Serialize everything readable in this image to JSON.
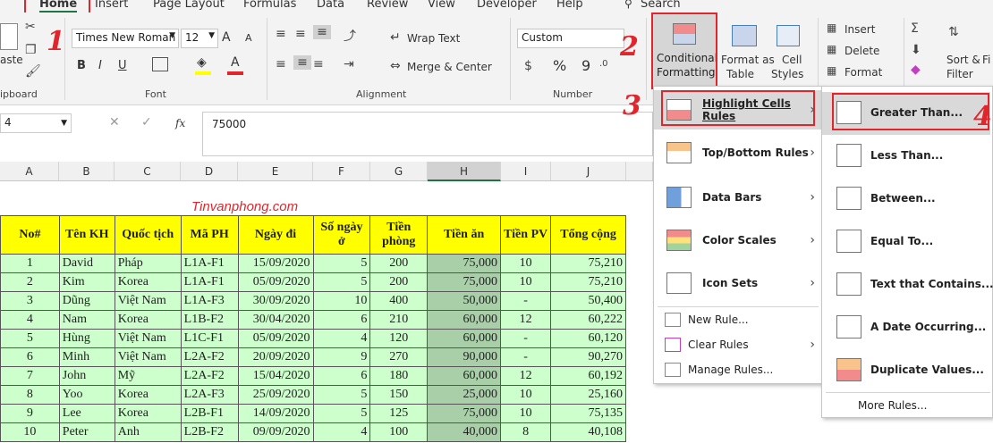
{
  "ribbon_tabs": [
    "Home",
    "Insert",
    "Page Layout",
    "Formulas",
    "Data",
    "Review",
    "View",
    "Developer",
    "Help"
  ],
  "search_label": "Search",
  "clipboard": {
    "paste": "aste",
    "group": "ipboard"
  },
  "font": {
    "name": "Times New Roman",
    "size": "12",
    "grow": "A",
    "shrink": "A",
    "bold": "B",
    "italic": "I",
    "underline": "U",
    "group": "Font"
  },
  "alignment": {
    "wrap": "Wrap Text",
    "merge": "Merge & Center",
    "group": "Alignment"
  },
  "number": {
    "format": "Custom",
    "percent": "%",
    "comma": "9",
    "group": "Number"
  },
  "styles": {
    "cf_line1": "Conditional",
    "cf_line2": "Formatting",
    "fat_line1": "Format as",
    "fat_line2": "Table",
    "cs_line1": "Cell",
    "cs_line2": "Styles"
  },
  "cells": {
    "insert": "Insert",
    "delete": "Delete",
    "format": "Format"
  },
  "editing": {
    "sort_line1": "Sort &",
    "sort_line2": "Filter",
    "find": "Fi"
  },
  "formula_bar": {
    "name_box": "4",
    "fx": "fx",
    "value": "75000"
  },
  "steps": [
    "1",
    "2",
    "3",
    "4"
  ],
  "columns": [
    "A",
    "B",
    "C",
    "D",
    "E",
    "F",
    "G",
    "H",
    "I",
    "J"
  ],
  "watermark": "Tinvanphong.com",
  "table": {
    "headers": [
      "No#",
      "Tên KH",
      "Quốc tịch",
      "Mã PH",
      "Ngày đi",
      "Số ngày ở",
      "Tiền phòng",
      "Tiền ăn",
      "Tiền PV",
      "Tổng cộng"
    ],
    "rows": [
      [
        "1",
        "David",
        "Pháp",
        "L1A-F1",
        "15/09/2020",
        "5",
        "200",
        "75,000",
        "10",
        "75,210"
      ],
      [
        "2",
        "Kim",
        "Korea",
        "L1A-F1",
        "05/09/2020",
        "5",
        "200",
        "75,000",
        "10",
        "75,210"
      ],
      [
        "3",
        "Dũng",
        "Việt Nam",
        "L1A-F3",
        "30/09/2020",
        "10",
        "400",
        "50,000",
        "-",
        "50,400"
      ],
      [
        "4",
        "Nam",
        "Korea",
        "L1B-F2",
        "30/04/2020",
        "6",
        "210",
        "60,000",
        "12",
        "60,222"
      ],
      [
        "5",
        "Hùng",
        "Việt Nam",
        "L1C-F1",
        "05/09/2020",
        "4",
        "120",
        "60,000",
        "-",
        "60,120"
      ],
      [
        "6",
        "Minh",
        "Việt Nam",
        "L2A-F2",
        "20/09/2020",
        "9",
        "270",
        "90,000",
        "-",
        "90,270"
      ],
      [
        "7",
        "John",
        "Mỹ",
        "L2A-F2",
        "15/04/2020",
        "6",
        "180",
        "60,000",
        "12",
        "60,192"
      ],
      [
        "8",
        "Yoo",
        "Korea",
        "L2A-F3",
        "25/09/2020",
        "5",
        "150",
        "25,000",
        "10",
        "25,160"
      ],
      [
        "9",
        "Lee",
        "Korea",
        "L2B-F1",
        "14/09/2020",
        "5",
        "125",
        "75,000",
        "10",
        "75,135"
      ],
      [
        "10",
        "Peter",
        "Anh",
        "L2B-F2",
        "09/09/2020",
        "4",
        "100",
        "40,000",
        "8",
        "40,108"
      ]
    ]
  },
  "cf_menu": {
    "items": [
      "Highlight Cells Rules",
      "Top/Bottom Rules",
      "Data Bars",
      "Color Scales",
      "Icon Sets"
    ],
    "small_items": [
      "New Rule...",
      "Clear Rules",
      "Manage Rules..."
    ]
  },
  "highlight_menu": {
    "items": [
      "Greater Than...",
      "Less Than...",
      "Between...",
      "Equal To...",
      "Text that Contains...",
      "A Date Occurring...",
      "Duplicate Values..."
    ],
    "more": "More Rules..."
  },
  "colors": {
    "accent_red": "#e0262c",
    "header_yellow": "#ffff00",
    "cell_green": "#ccffcc",
    "excel_green": "#217346"
  }
}
